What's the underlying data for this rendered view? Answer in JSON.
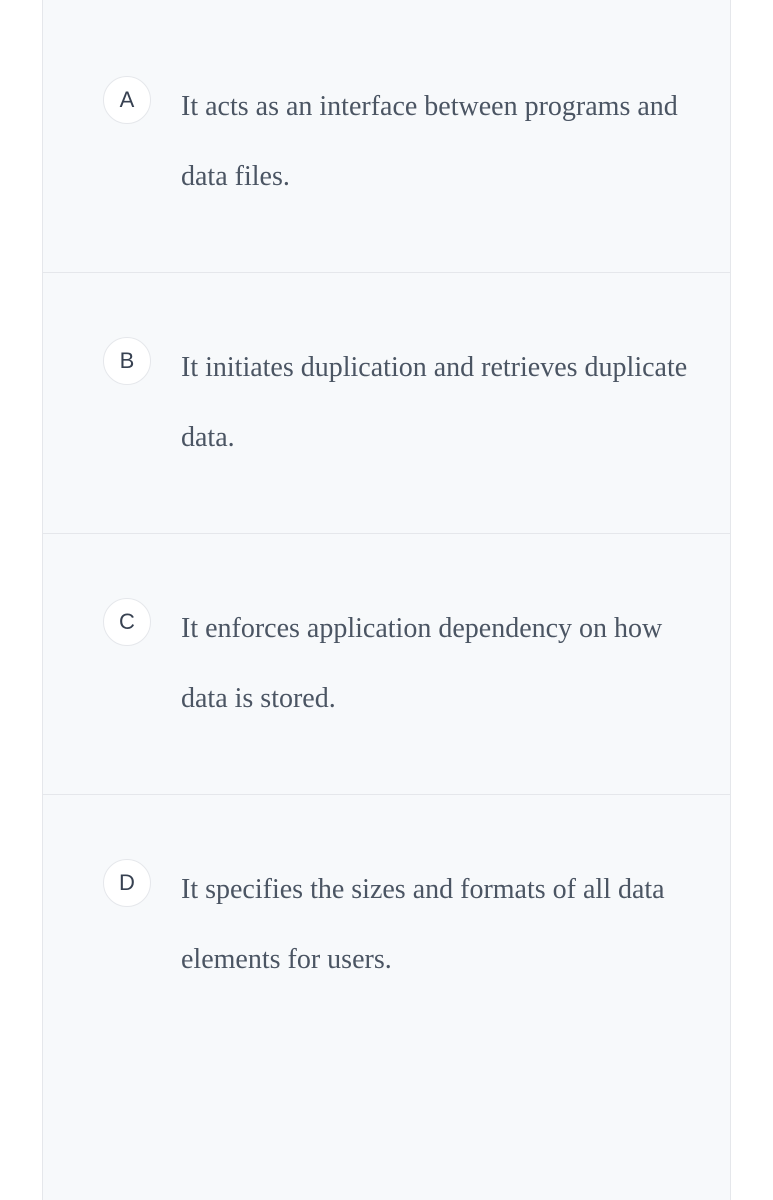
{
  "options": [
    {
      "letter": "A",
      "text": "It acts as an interface between programs and data files."
    },
    {
      "letter": "B",
      "text": "It initiates duplication and retrieves duplicate data."
    },
    {
      "letter": "C",
      "text": "It enforces application dependency on how data is stored."
    },
    {
      "letter": "D",
      "text": "It specifies the sizes and formats of all data elements for users."
    }
  ]
}
